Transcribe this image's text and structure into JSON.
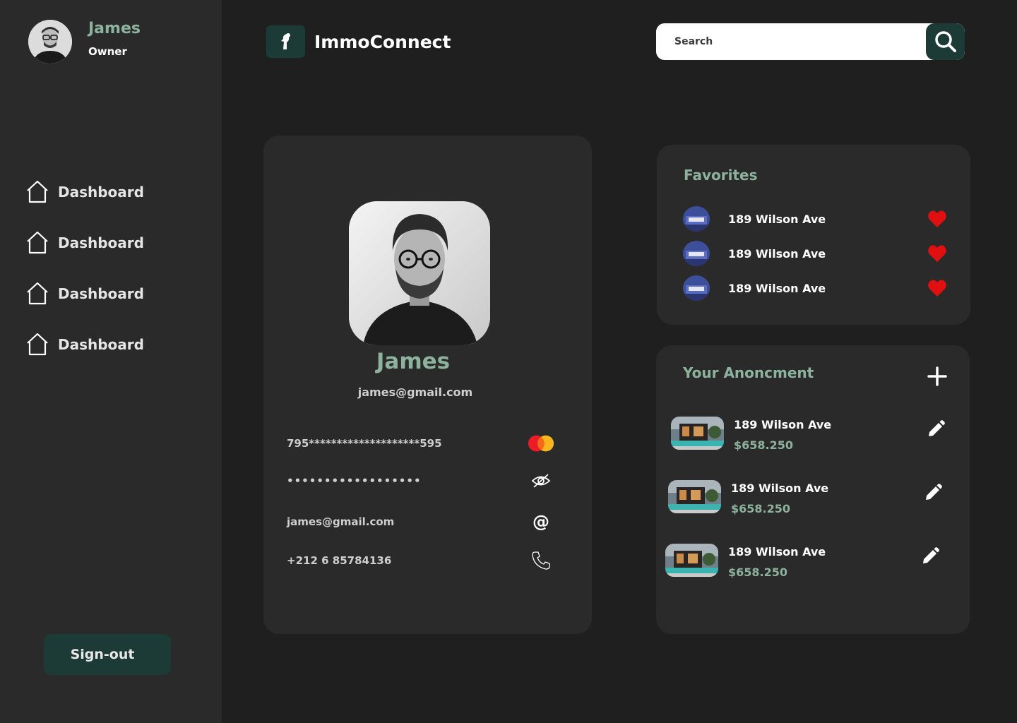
{
  "user": {
    "name": "James",
    "role": "Owner"
  },
  "nav": {
    "items": [
      {
        "label": "Dashboard",
        "icon": "home-icon"
      },
      {
        "label": "Dashboard",
        "icon": "home-icon"
      },
      {
        "label": "Dashboard",
        "icon": "home-icon"
      },
      {
        "label": "Dashboard",
        "icon": "home-icon"
      }
    ]
  },
  "signout_label": "Sign-out",
  "brand": {
    "name": "ImmoConnect",
    "logo_icon": "ambulance-man-icon"
  },
  "search": {
    "placeholder": "Search",
    "value": ""
  },
  "profile": {
    "name": "James",
    "email": "james@gmail.com",
    "card_number": "795********************595",
    "password_mask": "••••••••••••••••••",
    "contact_email": "james@gmail.com",
    "phone": "+212 6 85784136"
  },
  "favorites": {
    "title": "Favorites",
    "items": [
      {
        "label": "189 Wilson Ave"
      },
      {
        "label": "189 Wilson Ave"
      },
      {
        "label": "189 Wilson Ave"
      }
    ]
  },
  "announcements": {
    "title": "Your Anoncment",
    "items": [
      {
        "address": "189 Wilson Ave",
        "price": "$658.250"
      },
      {
        "address": "189 Wilson Ave",
        "price": "$658.250"
      },
      {
        "address": "189 Wilson Ave",
        "price": "$658.250"
      }
    ]
  },
  "colors": {
    "accent": "#8db39f",
    "brand_dark": "#1c3a36",
    "background": "#1f1f1f",
    "panel": "#2a2a2a",
    "heart": "#e01010"
  }
}
